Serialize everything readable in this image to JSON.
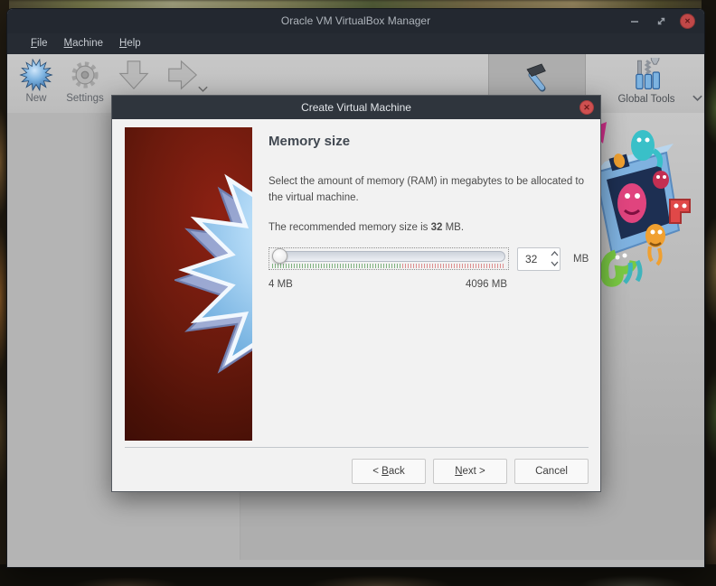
{
  "window": {
    "title": "Oracle VM VirtualBox Manager",
    "menu": {
      "file": {
        "mn": "F",
        "rest": "ile"
      },
      "machine": {
        "mn": "M",
        "rest": "achine"
      },
      "help": {
        "mn": "H",
        "rest": "elp"
      }
    },
    "toolbar": {
      "new_label": "New",
      "settings_label": "Settings",
      "global_tools_label": "Global Tools"
    }
  },
  "dialog": {
    "title": "Create Virtual Machine",
    "heading": "Memory size",
    "description": "Select the amount of memory (RAM) in megabytes to be allocated to the virtual machine.",
    "recommendation": {
      "prefix": "The recommended memory size is ",
      "value": "32",
      "suffix": " MB."
    },
    "memory": {
      "value": "32",
      "unit": "MB",
      "min_label": "4 MB",
      "max_label": "4096 MB"
    },
    "buttons": {
      "back": {
        "prefix": "< ",
        "mn": "B",
        "rest": "ack"
      },
      "next": {
        "mn": "N",
        "rest": "ext >"
      },
      "cancel": "Cancel"
    }
  },
  "colors": {
    "titlebar": "#232830",
    "dialog_titlebar": "#2f353d",
    "close_button": "#cf5050",
    "accent_blue": "#7db3e0",
    "slider_safe_ticks": "#7fb27f",
    "slider_unsafe_ticks": "#dd8f8f",
    "image_panel_red": "#6b1a0d"
  }
}
